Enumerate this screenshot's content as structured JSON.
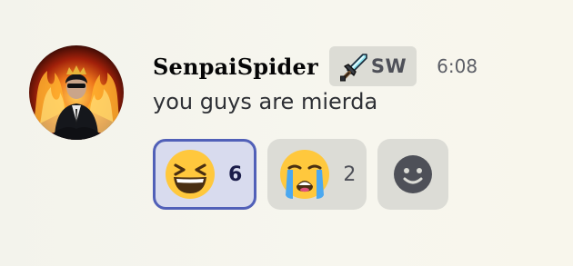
{
  "message": {
    "author": "SenpaiSpider",
    "tag": {
      "icon": "sword-icon",
      "label": "SW"
    },
    "timestamp": "6:08",
    "content": "you guys are mierda"
  },
  "reactions": [
    {
      "emoji": "grinning-squinting-face",
      "count": "6",
      "active": true
    },
    {
      "emoji": "loudly-crying-face",
      "count": "2",
      "active": false
    }
  ],
  "add_reaction": {
    "icon": "add-reaction-smiley-icon"
  },
  "colors": {
    "active_reaction_border": "#5160b8",
    "active_reaction_bg": "#d8dbee",
    "reaction_bg": "#dcdcd6"
  }
}
